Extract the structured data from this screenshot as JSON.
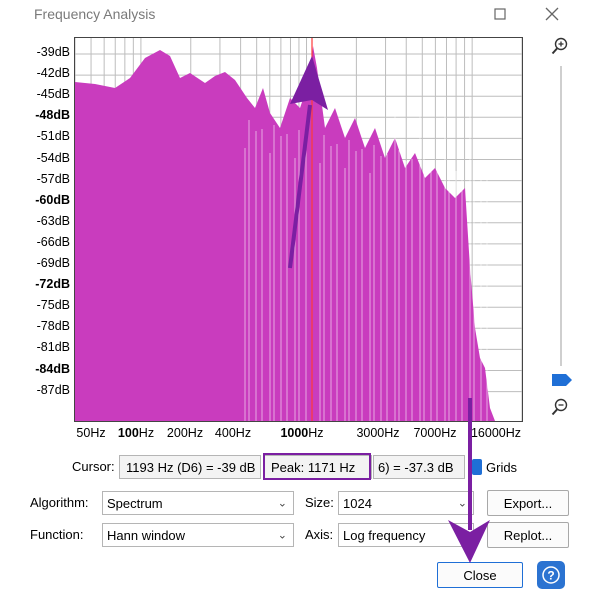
{
  "window": {
    "title": "Frequency Analysis"
  },
  "icons": {
    "maximize": "maximize-icon",
    "close": "close-icon",
    "zoom_in": "zoom-in-icon",
    "zoom_out": "zoom-out-icon",
    "help": "help-icon"
  },
  "plot": {
    "fill_color": "#c93cbe",
    "cursor_color": "#ff3a3a",
    "y_ticks": [
      {
        "label": "-39dB",
        "bold": false
      },
      {
        "label": "-42dB",
        "bold": false
      },
      {
        "label": "-45dB",
        "bold": false
      },
      {
        "label": "-48dB",
        "bold": true
      },
      {
        "label": "-51dB",
        "bold": false
      },
      {
        "label": "-54dB",
        "bold": false
      },
      {
        "label": "-57dB",
        "bold": false
      },
      {
        "label": "-60dB",
        "bold": true
      },
      {
        "label": "-63dB",
        "bold": false
      },
      {
        "label": "-66dB",
        "bold": false
      },
      {
        "label": "-69dB",
        "bold": false
      },
      {
        "label": "-72dB",
        "bold": true
      },
      {
        "label": "-75dB",
        "bold": false
      },
      {
        "label": "-78dB",
        "bold": false
      },
      {
        "label": "-81dB",
        "bold": false
      },
      {
        "label": "-84dB",
        "bold": true
      },
      {
        "label": "-87dB",
        "bold": false
      }
    ],
    "x_ticks": [
      {
        "num": "50",
        "unit": "Hz",
        "bold": false
      },
      {
        "num": "100",
        "unit": "Hz",
        "bold": true
      },
      {
        "num": "200",
        "unit": "Hz",
        "bold": false
      },
      {
        "num": "400",
        "unit": "Hz",
        "bold": false
      },
      {
        "num": "1000",
        "unit": "Hz",
        "bold": true
      },
      {
        "num": "3000",
        "unit": "Hz",
        "bold": false
      },
      {
        "num": "7000",
        "unit": "Hz",
        "bold": false
      },
      {
        "num": "16000",
        "unit": "Hz",
        "bold": false
      }
    ]
  },
  "info": {
    "cursor_label": "Cursor:",
    "cursor_value": "1193 Hz (D6) = -39 dB",
    "peak_value": "Peak: 1171 Hz",
    "peak_rest": "6) = -37.3 dB",
    "grids_label": "Grids"
  },
  "controls": {
    "algorithm_label": "Algorithm:",
    "algorithm_value": "Spectrum",
    "size_label": "Size:",
    "size_value": "1024",
    "export_label": "Export...",
    "function_label": "Function:",
    "function_value": "Hann window",
    "axis_label": "Axis:",
    "axis_value": "Log frequency",
    "replot_label": "Replot...",
    "close_label": "Close"
  },
  "annotation": {
    "color": "#7b1fa2"
  }
}
